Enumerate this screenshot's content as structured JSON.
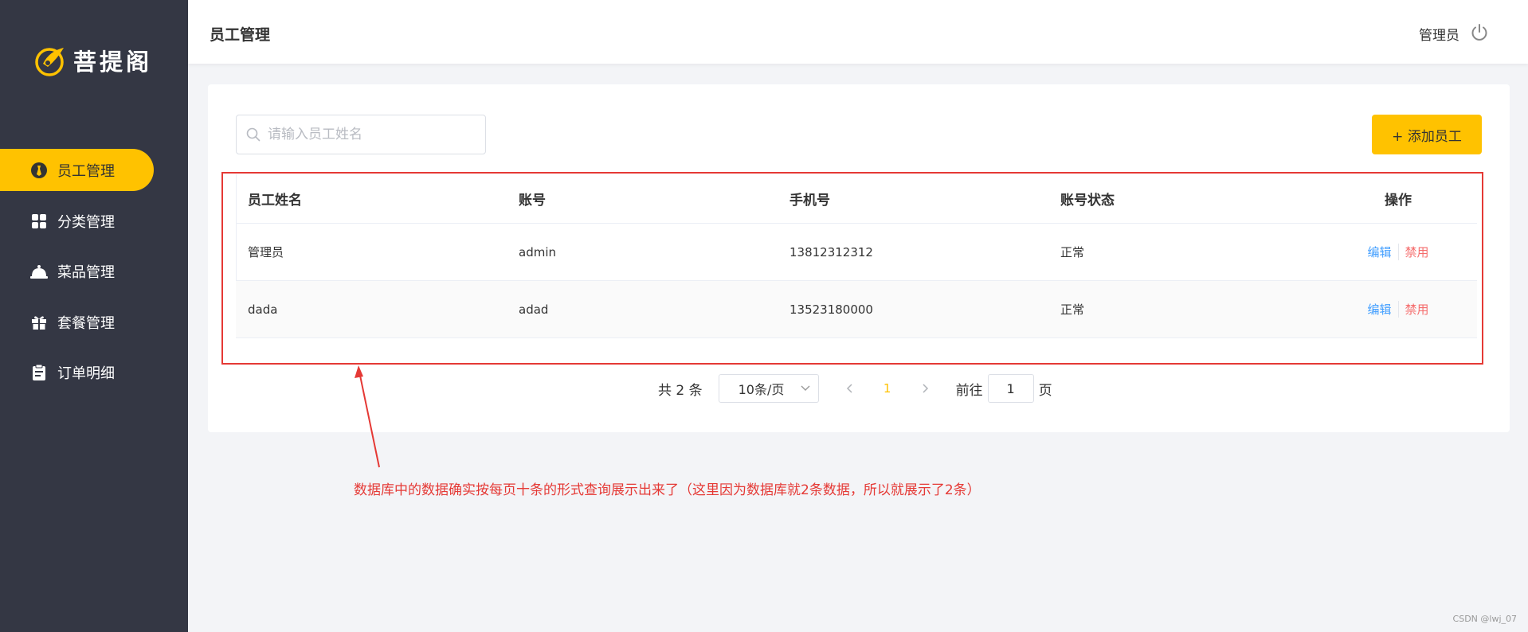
{
  "app": {
    "logo_text": "菩提阁",
    "brand_color": "#ffc200",
    "sidebar_bg": "#343744"
  },
  "sidebar": {
    "items": [
      {
        "label": "员工管理",
        "icon": "employee-icon",
        "active": true
      },
      {
        "label": "分类管理",
        "icon": "grid-icon",
        "active": false
      },
      {
        "label": "菜品管理",
        "icon": "dish-cover-icon",
        "active": false
      },
      {
        "label": "套餐管理",
        "icon": "gift-icon",
        "active": false
      },
      {
        "label": "订单明细",
        "icon": "clipboard-icon",
        "active": false
      }
    ]
  },
  "header": {
    "title": "员工管理",
    "user": "管理员",
    "logout_icon": "power-icon"
  },
  "toolbar": {
    "search_placeholder": "请输入员工姓名",
    "add_button": "+ 添加员工"
  },
  "table": {
    "columns": [
      "员工姓名",
      "账号",
      "手机号",
      "账号状态",
      "操作"
    ],
    "rows": [
      {
        "name": "管理员",
        "account": "admin",
        "phone": "13812312312",
        "status": "正常",
        "edit": "编辑",
        "disable": "禁用"
      },
      {
        "name": "dada",
        "account": "adad",
        "phone": "13523180000",
        "status": "正常",
        "edit": "编辑",
        "disable": "禁用"
      }
    ]
  },
  "pagination": {
    "total": "共 2 条",
    "page_size": "10条/页",
    "current_page": "1",
    "goto_label": "前往",
    "goto_value": "1",
    "goto_suffix": "页"
  },
  "annotation": {
    "text": "数据库中的数据确实按每页十条的形式查询展示出来了（这里因为数据库就2条数据，所以就展示了2条）",
    "color": "#e53935"
  },
  "watermark": "CSDN @lwj_07"
}
